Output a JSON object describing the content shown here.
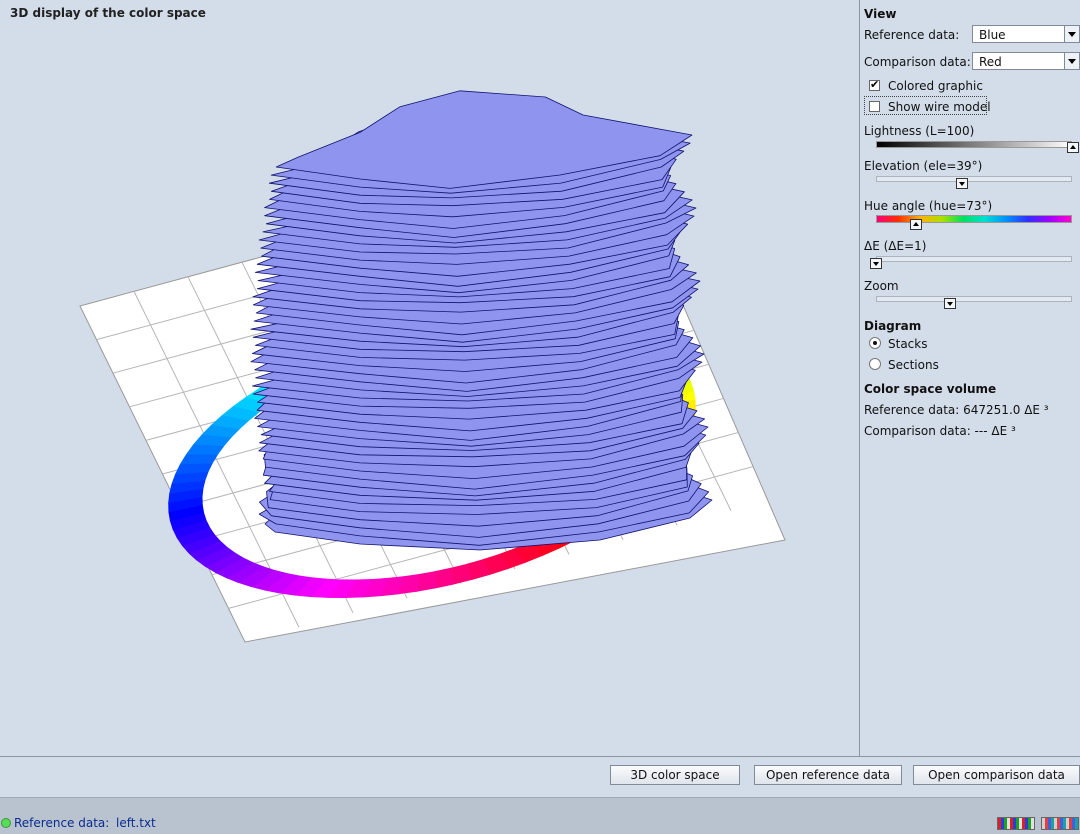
{
  "title": "3D display of the color space",
  "view": {
    "heading": "View",
    "reference_label": "Reference data:",
    "reference_value": "Blue",
    "comparison_label": "Comparison data:",
    "comparison_value": "Red",
    "colored_graphic_label": "Colored graphic",
    "colored_graphic_checked": true,
    "wire_model_label": "Show wire model",
    "wire_model_checked": false,
    "lightness_label": "Lightness  (L=100)",
    "lightness_level": 1.0,
    "elevation_label": "Elevation  (ele=39°)",
    "elevation_level": 0.44,
    "hue_label": "Hue angle  (hue=73°)",
    "hue_level": 0.2,
    "delta_label": "ΔE  (ΔE=1)",
    "delta_level": 0.0,
    "zoom_label": "Zoom",
    "zoom_level": 0.38
  },
  "diagram": {
    "heading": "Diagram",
    "options": [
      "Stacks",
      "Sections"
    ],
    "selected": "Stacks"
  },
  "volume": {
    "heading": "Color space volume",
    "reference": "Reference data: 647251.0 ΔE ³",
    "comparison": "Comparison data: --- ΔE ³"
  },
  "buttons": {
    "color_space": "3D color space",
    "open_reference": "Open reference data",
    "open_comparison": "Open comparison data"
  },
  "status": {
    "label": "Reference data:",
    "file": "left.txt"
  },
  "colors": {
    "background": "#d3dde9",
    "volume_fill": "#8f94ee",
    "volume_stroke": "#10126e"
  }
}
